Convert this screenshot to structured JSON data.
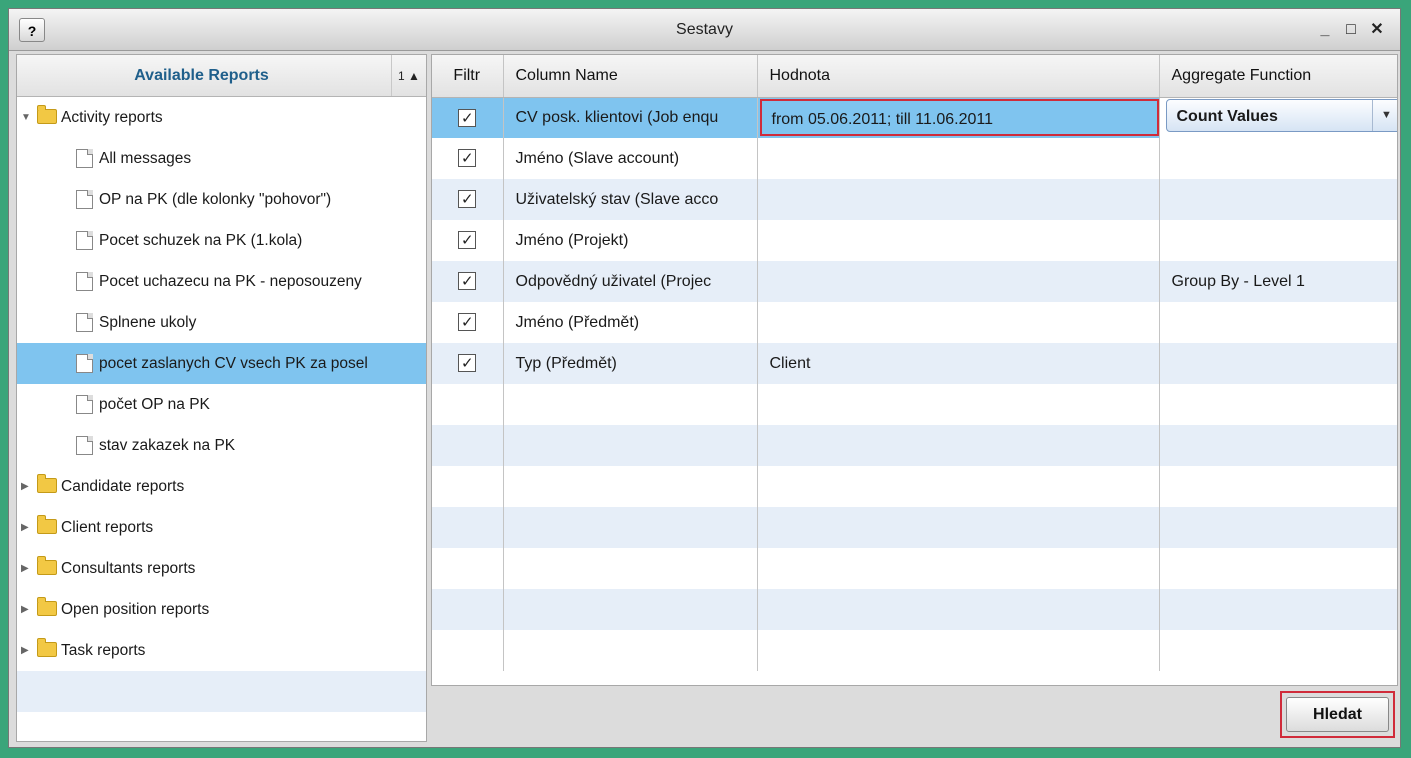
{
  "window": {
    "title": "Sestavy",
    "help_label": "?",
    "minimize_label": "_",
    "maximize_label": "□",
    "close_label": "✕"
  },
  "left_panel": {
    "header": "Available Reports",
    "sort_label": "1 ▲",
    "tree": [
      {
        "type": "folder",
        "expanded": true,
        "label": "Activity reports"
      },
      {
        "type": "doc",
        "label": "All messages"
      },
      {
        "type": "doc",
        "label": "OP na PK (dle kolonky \"pohovor\")"
      },
      {
        "type": "doc",
        "label": "Pocet schuzek na PK (1.kola)"
      },
      {
        "type": "doc",
        "label": "Pocet uchazecu na PK - neposouzeny"
      },
      {
        "type": "doc",
        "label": "Splnene ukoly"
      },
      {
        "type": "doc",
        "label": "pocet zaslanych CV vsech PK za posel",
        "selected": true
      },
      {
        "type": "doc",
        "label": "počet OP na PK"
      },
      {
        "type": "doc",
        "label": "stav zakazek na PK"
      },
      {
        "type": "folder",
        "expanded": false,
        "label": "Candidate reports"
      },
      {
        "type": "folder",
        "expanded": false,
        "label": "Client reports"
      },
      {
        "type": "folder",
        "expanded": false,
        "label": "Consultants reports"
      },
      {
        "type": "folder",
        "expanded": false,
        "label": "Open position reports"
      },
      {
        "type": "folder",
        "expanded": false,
        "label": "Task reports"
      }
    ]
  },
  "grid": {
    "columns": [
      "Filtr",
      "Column Name",
      "Hodnota",
      "Aggregate Function"
    ],
    "rows": [
      {
        "checked": true,
        "column_name": "CV posk. klientovi (Job enqu",
        "value": "from 05.06.2011; till 11.06.2011",
        "aggregate": "Count Values",
        "selected": true
      },
      {
        "checked": true,
        "column_name": "Jméno (Slave account)",
        "value": "",
        "aggregate": ""
      },
      {
        "checked": true,
        "column_name": "Uživatelský stav (Slave acco",
        "value": "",
        "aggregate": ""
      },
      {
        "checked": true,
        "column_name": "Jméno (Projekt)",
        "value": "",
        "aggregate": ""
      },
      {
        "checked": true,
        "column_name": "Odpovědný uživatel (Projec",
        "value": "",
        "aggregate": "Group By - Level 1"
      },
      {
        "checked": true,
        "column_name": "Jméno (Předmět)",
        "value": "",
        "aggregate": ""
      },
      {
        "checked": true,
        "column_name": "Typ (Předmět)",
        "value": "Client",
        "aggregate": ""
      }
    ],
    "check_glyph": "✓",
    "dropdown_glyph": "▼"
  },
  "footer": {
    "search_label": "Hledat"
  },
  "colors": {
    "selection": "#7fc4ef",
    "alt_row": "#e6eef8",
    "highlight_border": "#d02b3a",
    "background": "#3aa57a"
  }
}
